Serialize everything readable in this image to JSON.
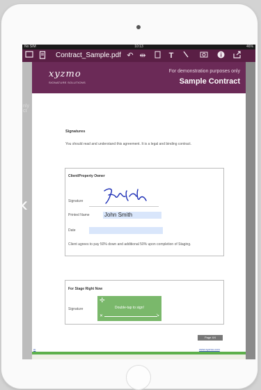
{
  "statusbar": {
    "carrier": "No SIM",
    "time": "10:13",
    "battery": "46%"
  },
  "toolbar": {
    "title": "Contract_Sample.pdf",
    "icons": [
      "thumbnails-icon",
      "document-icon",
      "undo-icon",
      "fit-width-icon",
      "page-icon",
      "text-icon",
      "pen-icon",
      "camera-icon",
      "info-icon",
      "share-icon"
    ]
  },
  "side": {
    "left_ghost": [
      "nly",
      "ct"
    ]
  },
  "doc": {
    "logo": "xyzmo",
    "logo_sub": "SIGNATURE SOLUTIONS",
    "demo_note": "For demonstration purposes only",
    "title": "Sample Contract",
    "section_title": "Signatures",
    "intro": "You should read and understand this agreement. It is a legal and binding contract.",
    "client_box": {
      "title": "Client/Property Owner",
      "signature_label": "Signature",
      "printed_name_label": "Printed Name",
      "printed_name_value": "John Smith",
      "date_label": "Date",
      "date_value": "",
      "agreement": "Client agrees to pay 50% down and additional 50% upon completion of Staging."
    },
    "stage_box": {
      "title": "For Stage Right Now",
      "signature_label": "Signature",
      "pad_text": "Double-tap to sign!"
    },
    "page_indicator": "Page 4/4",
    "links": {
      "left": "m",
      "right": "www.xyzmo.com"
    }
  },
  "colors": {
    "toolbar": "#5a1f45",
    "header": "#6b2a57",
    "field": "#d9e6fb",
    "sign_pad": "#7ab86b",
    "footer_line": "#5db04b"
  }
}
